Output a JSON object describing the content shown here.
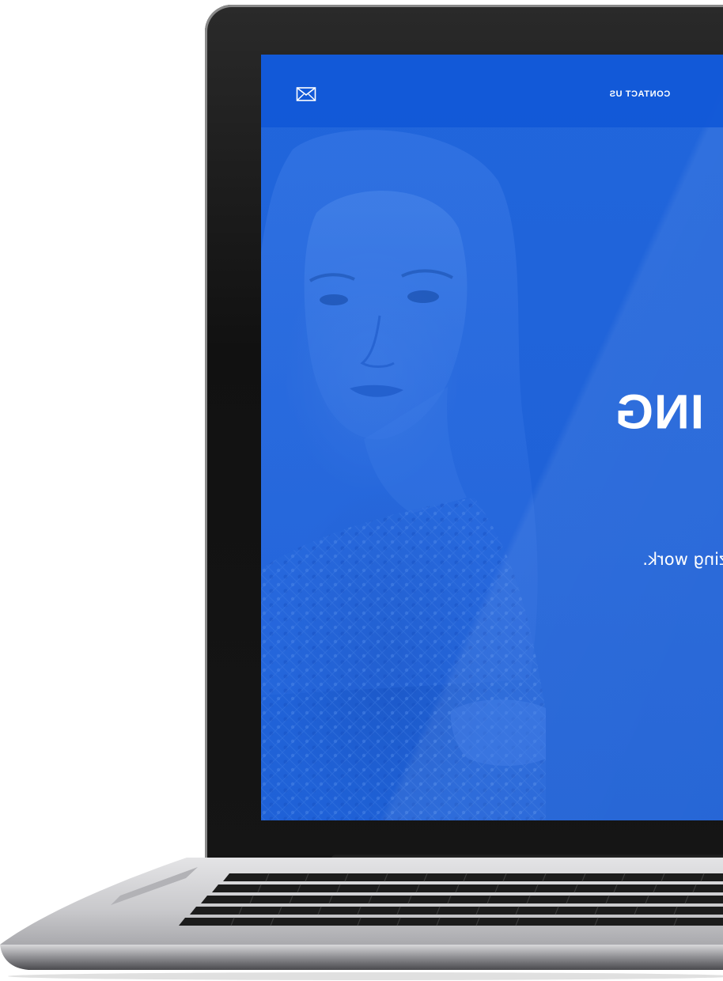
{
  "header": {
    "contact_label": "CONTACT US",
    "mail_icon": "envelope-icon"
  },
  "hero": {
    "heading_visible": "ING",
    "subtitle_visible": "zing work."
  },
  "colors": {
    "screen_blue": "#1d63d9",
    "header_blue": "#1258d7",
    "laptop_bezel": "#111111",
    "laptop_body": "#c8c8c8",
    "keyboard": "#1c1c1c"
  }
}
